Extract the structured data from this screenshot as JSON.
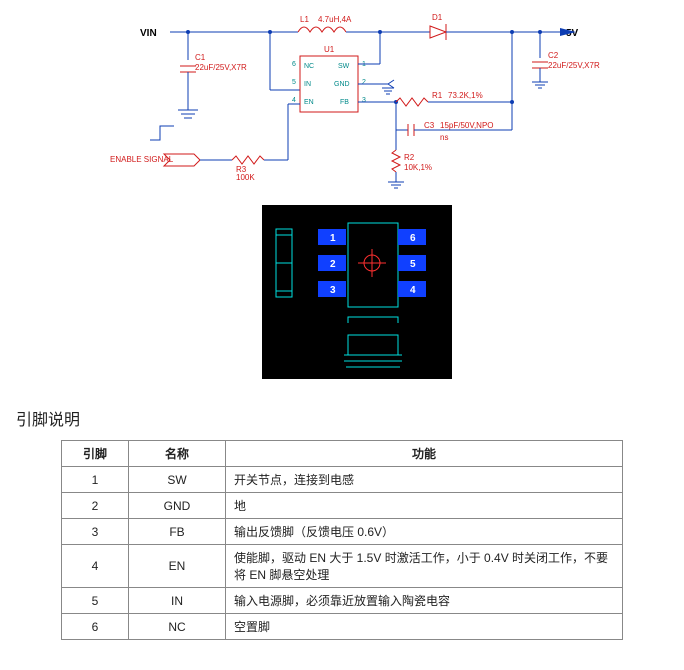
{
  "schematic": {
    "vin_label": "VIN",
    "out_label": "5V",
    "enable_label": "ENABLE SIGNAL",
    "ic": {
      "ref": "U1",
      "pins": {
        "nc": "NC",
        "sw": "SW",
        "in": "IN",
        "gnd": "GND",
        "en": "EN",
        "fb": "FB"
      },
      "nums": {
        "nc": "6",
        "sw": "1",
        "in": "5",
        "gnd": "2",
        "en": "4",
        "fb": "3"
      }
    },
    "L1": {
      "ref": "L1",
      "val": "4.7uH,4A"
    },
    "D1": {
      "ref": "D1"
    },
    "C1": {
      "ref": "C1",
      "val": "22uF/25V,X7R"
    },
    "C2": {
      "ref": "C2",
      "val": "22uF/25V,X7R"
    },
    "C3": {
      "ref": "C3",
      "val": "15pF/50V,NPO",
      "note": "ns"
    },
    "R1": {
      "ref": "R1",
      "val": "73.2K,1%"
    },
    "R2": {
      "ref": "R2",
      "val": "10K,1%"
    },
    "R3": {
      "ref": "R3",
      "val": "100K"
    }
  },
  "pcb": {
    "p1": "1",
    "p2": "2",
    "p3": "3",
    "p4": "4",
    "p5": "5",
    "p6": "6"
  },
  "section_title": "引脚说明",
  "table": {
    "h_pin": "引脚",
    "h_name": "名称",
    "h_func": "功能",
    "rows": [
      {
        "pin": "1",
        "name": "SW",
        "func": "开关节点，连接到电感"
      },
      {
        "pin": "2",
        "name": "GND",
        "func": "地"
      },
      {
        "pin": "3",
        "name": "FB",
        "func": "输出反馈脚（反馈电压 0.6V）"
      },
      {
        "pin": "4",
        "name": "EN",
        "func": "使能脚，驱动 EN 大于 1.5V 时激活工作，小于 0.4V 时关闭工作，不要将 EN 脚悬空处理"
      },
      {
        "pin": "5",
        "name": "IN",
        "func": "输入电源脚，必须靠近放置输入陶瓷电容"
      },
      {
        "pin": "6",
        "name": "NC",
        "func": "空置脚"
      }
    ]
  }
}
